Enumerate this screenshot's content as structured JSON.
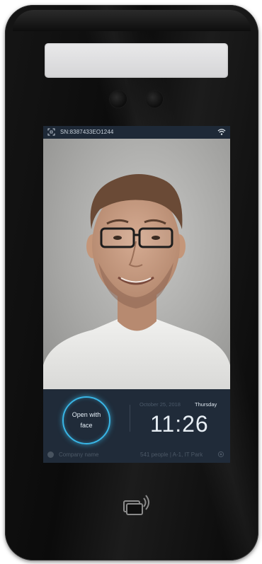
{
  "device": {
    "status_bar": {
      "serial": "SN:8387433EO1244",
      "icons": [
        "scan-icon",
        "wifi-icon"
      ]
    },
    "panel": {
      "face_button_label_line1": "Open with",
      "face_button_label_line2": "face",
      "date": "October 25, 2018",
      "weekday": "Thursday",
      "time": "11:26",
      "company_name": "Company name",
      "location": "541 people  |  A-1, IT Park",
      "icons": [
        "company-icon",
        "settings-icon"
      ]
    },
    "colors": {
      "accent": "#39b6e6",
      "screen_bg": "#202b39",
      "device_body": "#0e0e0e"
    }
  }
}
